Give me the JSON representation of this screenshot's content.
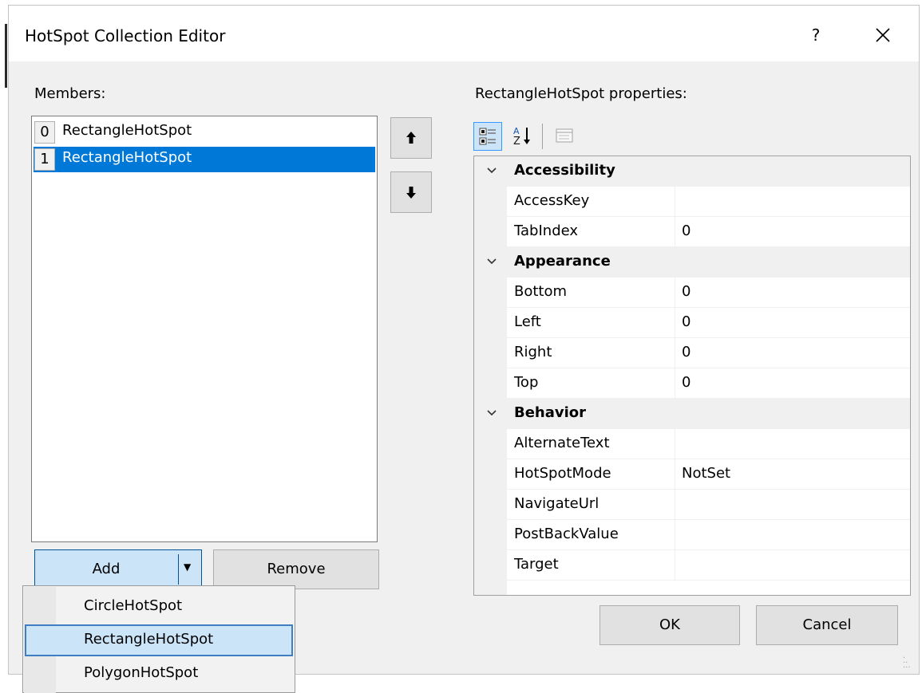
{
  "window": {
    "title": "HotSpot Collection Editor",
    "help_label": "?",
    "close_label": "✕"
  },
  "members": {
    "label": "Members:",
    "items": [
      {
        "index": "0",
        "name": "RectangleHotSpot",
        "selected": false
      },
      {
        "index": "1",
        "name": "RectangleHotSpot",
        "selected": true
      }
    ],
    "move_up_icon": "arrow-up-icon",
    "move_down_icon": "arrow-down-icon",
    "add_label": "Add",
    "remove_label": "Remove",
    "add_menu": [
      {
        "label": "CircleHotSpot",
        "highlighted": false
      },
      {
        "label": "RectangleHotSpot",
        "highlighted": true
      },
      {
        "label": "PolygonHotSpot",
        "highlighted": false
      }
    ]
  },
  "properties": {
    "label": "RectangleHotSpot properties:",
    "toolbar": {
      "categorized_icon": "categorized-icon",
      "alphabetical_icon": "alphabetical-sort-icon",
      "property_pages_icon": "property-pages-icon"
    },
    "grid": [
      {
        "type": "category",
        "name": "Accessibility"
      },
      {
        "type": "property",
        "name": "AccessKey",
        "value": ""
      },
      {
        "type": "property",
        "name": "TabIndex",
        "value": "0"
      },
      {
        "type": "category",
        "name": "Appearance"
      },
      {
        "type": "property",
        "name": "Bottom",
        "value": "0"
      },
      {
        "type": "property",
        "name": "Left",
        "value": "0"
      },
      {
        "type": "property",
        "name": "Right",
        "value": "0"
      },
      {
        "type": "property",
        "name": "Top",
        "value": "0"
      },
      {
        "type": "category",
        "name": "Behavior"
      },
      {
        "type": "property",
        "name": "AlternateText",
        "value": ""
      },
      {
        "type": "property",
        "name": "HotSpotMode",
        "value": "NotSet"
      },
      {
        "type": "property",
        "name": "NavigateUrl",
        "value": ""
      },
      {
        "type": "property",
        "name": "PostBackValue",
        "value": ""
      },
      {
        "type": "property",
        "name": "Target",
        "value": ""
      }
    ]
  },
  "footer": {
    "ok_label": "OK",
    "cancel_label": "Cancel"
  },
  "colors": {
    "selection": "#0078d7",
    "hover": "#cce4f7",
    "dialog_bg": "#f0f0f0"
  }
}
